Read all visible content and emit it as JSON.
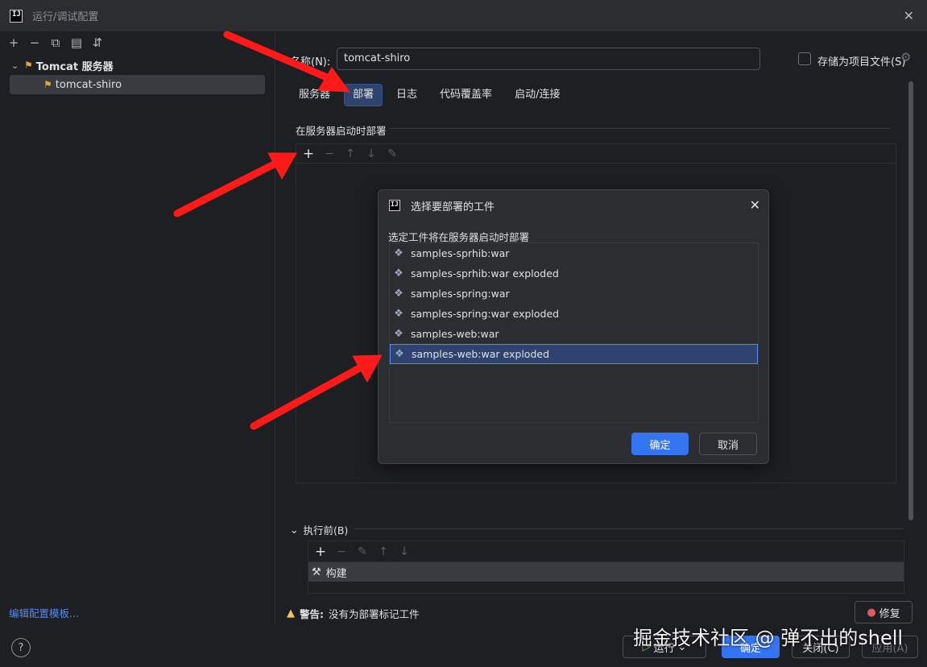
{
  "window": {
    "title": "运行/调试配置"
  },
  "left": {
    "toolbar": [
      "+",
      "−",
      "copy",
      "folder",
      "sort"
    ],
    "tree": {
      "parent_label": "Tomcat 服务器",
      "child_label": "tomcat-shiro"
    },
    "edit_templates_link": "编辑配置模板...",
    "help_label": "?"
  },
  "config": {
    "name_label": "名称(N):",
    "name_value": "tomcat-shiro",
    "store_as_project_file": "存储为项目文件(S)",
    "tabs": [
      {
        "label": "服务器",
        "active": false
      },
      {
        "label": "部署",
        "active": true
      },
      {
        "label": "日志",
        "active": false
      },
      {
        "label": "代码覆盖率",
        "active": false
      },
      {
        "label": "启动/连接",
        "active": false
      }
    ],
    "deploy_section_title": "在服务器启动时部署",
    "before_launch_label": "执行前(B)",
    "before_launch_task": "构建",
    "warning_label": "警告:",
    "warning_text": "没有为部署标记工件",
    "fix_button": "修复"
  },
  "footer": {
    "run_button": "运行",
    "ok_button": "确定",
    "close_button": "关闭(C)",
    "apply_button": "应用(A)"
  },
  "dialog": {
    "title": "选择要部署的工件",
    "description": "选定工件将在服务器启动时部署",
    "artifacts": [
      "samples-sprhib:war",
      "samples-sprhib:war exploded",
      "samples-spring:war",
      "samples-spring:war exploded",
      "samples-web:war",
      "samples-web:war exploded"
    ],
    "selected_index": 5,
    "ok_button": "确定",
    "cancel_button": "取消"
  },
  "watermark": "掘金技术社区 @ 弹不出的shell",
  "colors": {
    "accent": "#3574f0",
    "selection": "#2e436e",
    "annotation_arrow": "#ff1a1a"
  }
}
